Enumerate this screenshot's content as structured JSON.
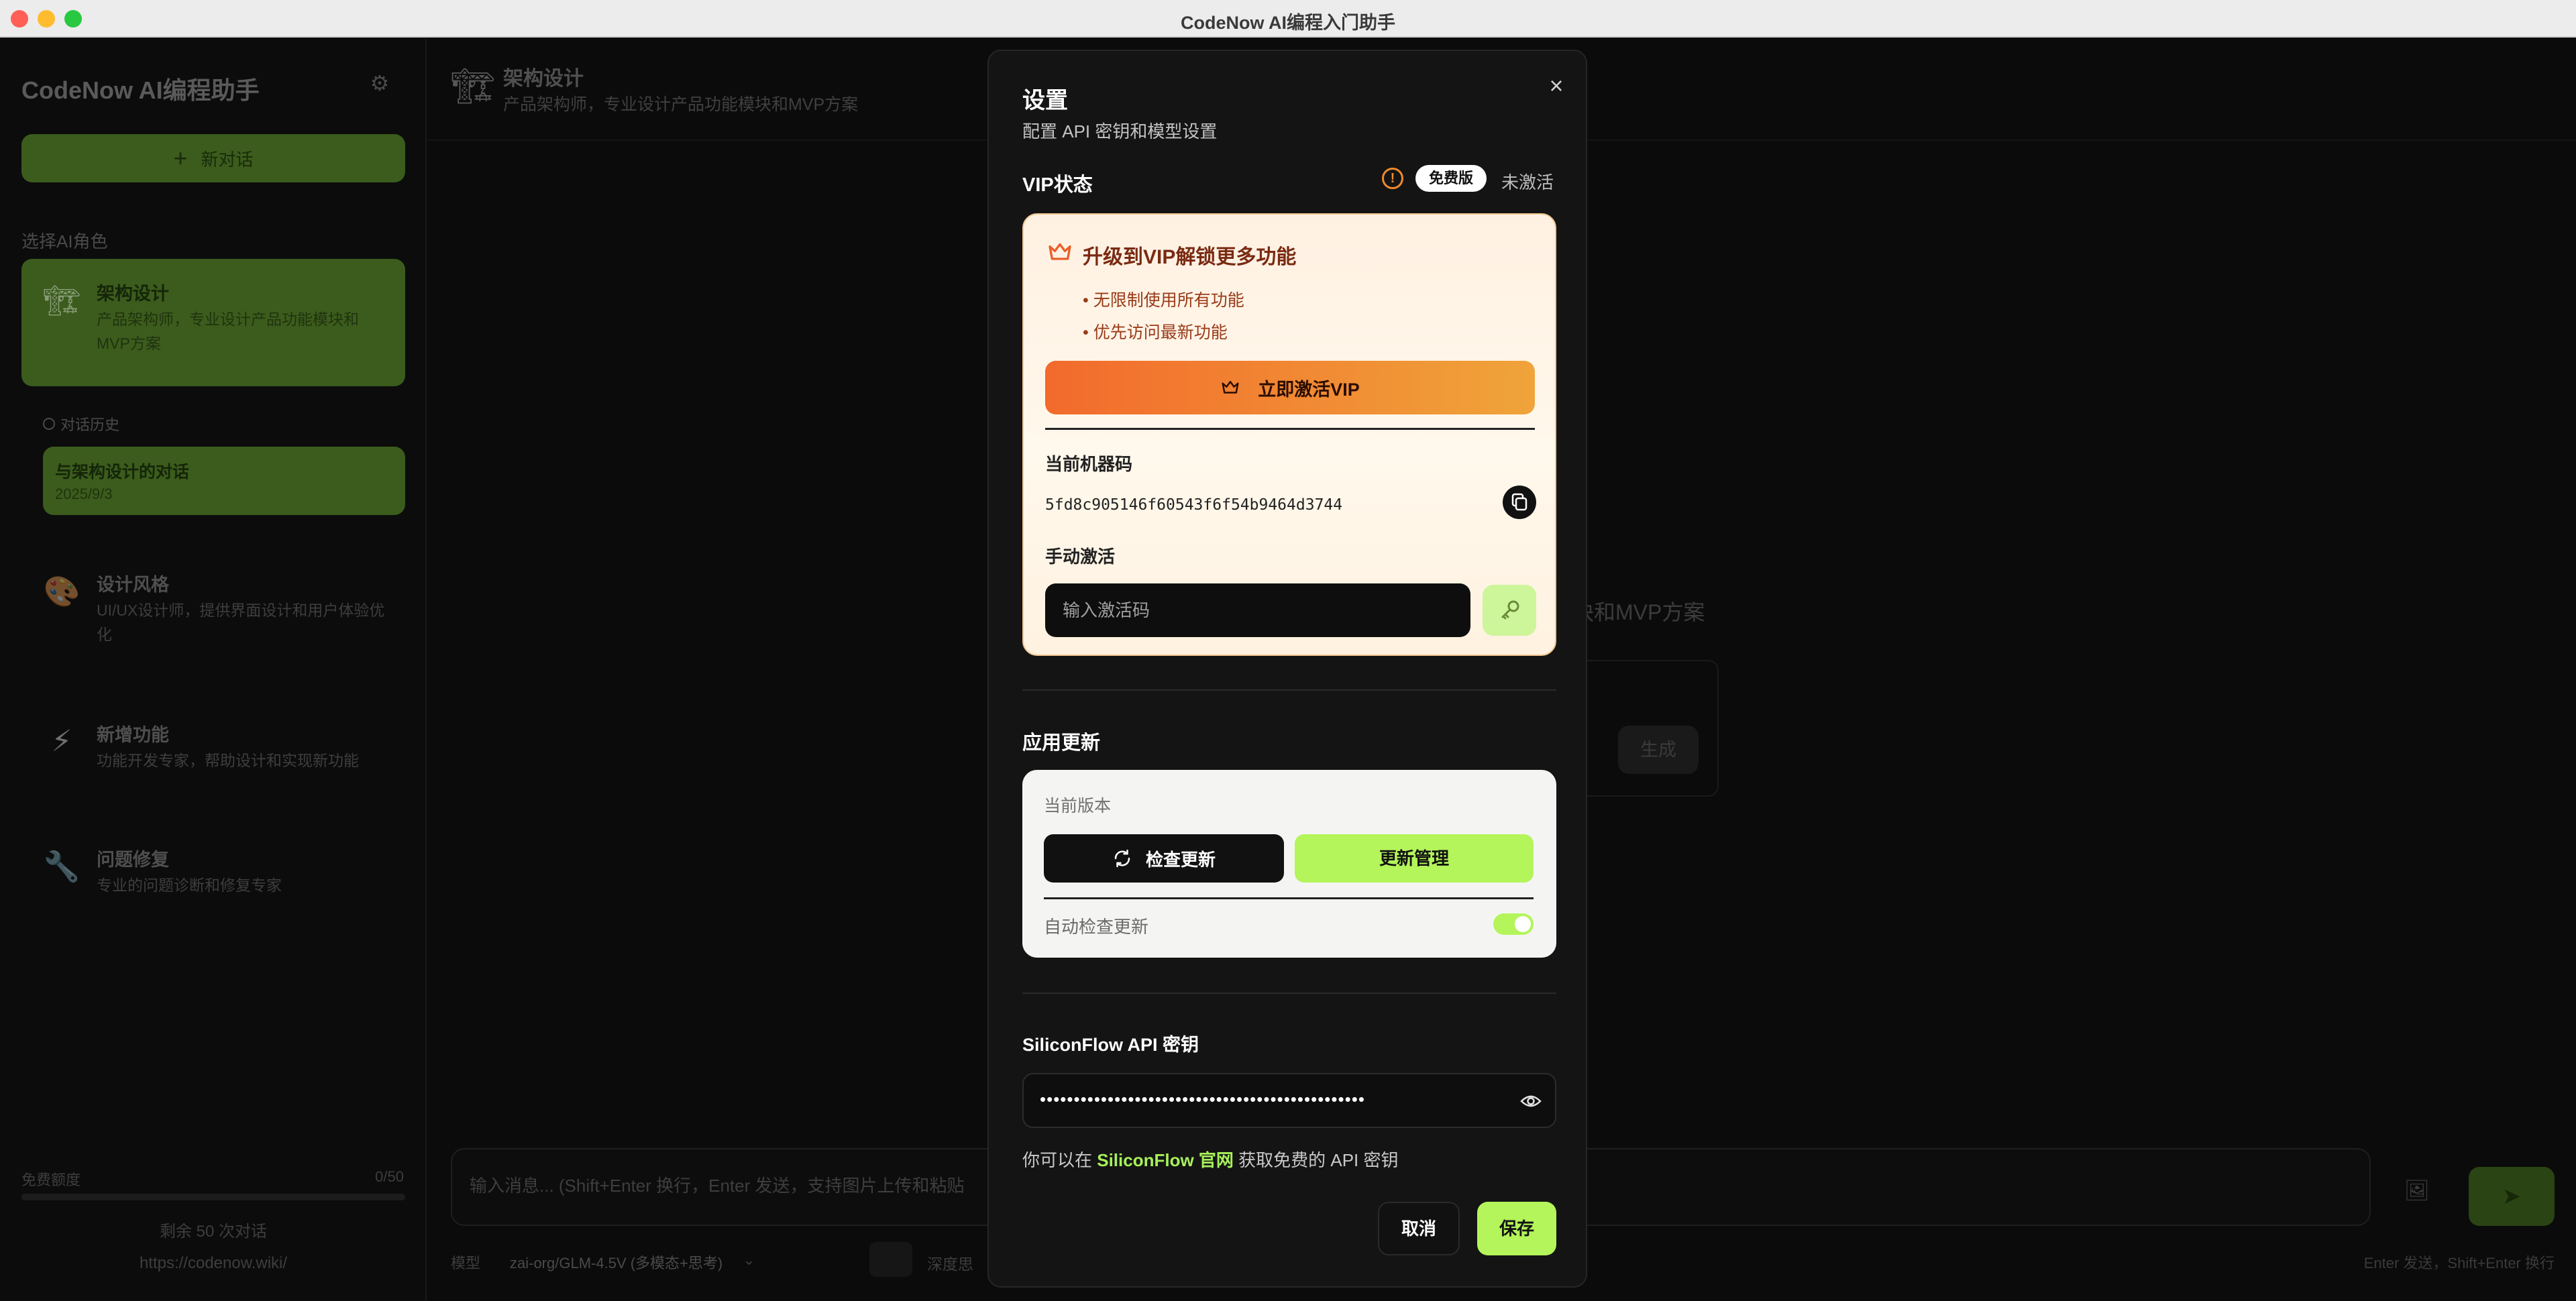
{
  "window": {
    "title": "CodeNow AI编程入门助手"
  },
  "sidebar": {
    "app_title": "CodeNow AI编程助手",
    "new_chat_label": "新对话",
    "section_label": "选择AI角色",
    "roles": [
      {
        "name": "架构设计",
        "desc": "产品架构师，专业设计产品功能模块和MVP方案",
        "icon": "construction-crane-icon",
        "active": true
      },
      {
        "name": "设计风格",
        "desc": "UI/UX设计师，提供界面设计和用户体验优化",
        "icon": "palette-icon"
      },
      {
        "name": "新增功能",
        "desc": "功能开发专家，帮助设计和实现新功能",
        "icon": "lightning-icon"
      },
      {
        "name": "问题修复",
        "desc": "专业的问题诊断和修复专家",
        "icon": "wrench-icon"
      }
    ],
    "history_label": "对话历史",
    "history": [
      {
        "title": "与架构设计的对话",
        "date": "2025/9/3"
      }
    ],
    "quota_label": "免费额度",
    "quota_value": "0/50",
    "quota_progress": 0,
    "remaining": "剩余 50 次对话",
    "site": "https://codenow.wiki/"
  },
  "main": {
    "header_title": "架构设计",
    "header_subtitle": "产品架构师，专业设计产品功能模块和MVP方案",
    "welcome_tail": "块和MVP方案",
    "generate_label": "生成",
    "composer_placeholder": "输入消息... (Shift+Enter 换行，Enter 发送，支持图片上传和粘贴",
    "model_label": "模型",
    "model_value": "zai-org/GLM-4.5V (多模态+思考)",
    "deep_label": "深度思",
    "send_hint": "Enter 发送，Shift+Enter 换行"
  },
  "modal": {
    "title": "设置",
    "subtitle": "配置 API 密钥和模型设置",
    "vip": {
      "heading": "VIP状态",
      "badge": "免费版",
      "status": "未激活",
      "upgrade_title": "升级到VIP解锁更多功能",
      "benefits": [
        "• 无限制使用所有功能",
        "• 优先访问最新功能"
      ],
      "activate_label": "立即激活VIP",
      "machine_label": "当前机器码",
      "machine_code": "5fd8c905146f60543f6f54b9464d3744",
      "manual_label": "手动激活",
      "code_placeholder": "输入激活码"
    },
    "update": {
      "heading": "应用更新",
      "current_version_label": "当前版本",
      "check_label": "检查更新",
      "manage_label": "更新管理",
      "auto_check_label": "自动检查更新",
      "auto_check_on": true
    },
    "api": {
      "heading": "SiliconFlow API 密钥",
      "masked_key": "••••••••••••••••••••••••••••••••••••••••••••••••",
      "help_prefix": "你可以在 ",
      "help_link": "SiliconFlow 官网",
      "help_suffix": " 获取免费的 API 密钥"
    },
    "cancel_label": "取消",
    "save_label": "保存"
  },
  "colors": {
    "accent": "#b3f55a",
    "vip_orange": "#f26a2c",
    "modal_bg": "#141414"
  }
}
